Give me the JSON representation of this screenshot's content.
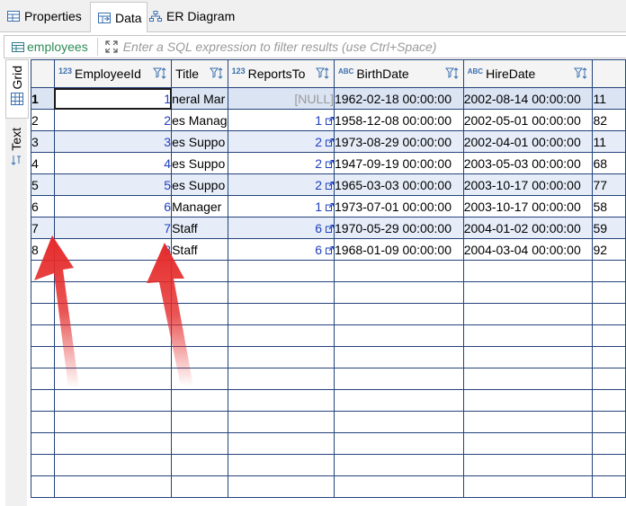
{
  "tabs": [
    {
      "label": "Properties",
      "icon": "table-icon",
      "active": false
    },
    {
      "label": "Data",
      "icon": "data-table-icon",
      "active": true
    },
    {
      "label": "ER Diagram",
      "icon": "er-diagram-icon",
      "active": false
    }
  ],
  "filter": {
    "table_name": "employees",
    "placeholder": "Enter a SQL expression to filter results (use Ctrl+Space)"
  },
  "side_tabs": [
    "Grid",
    "Text"
  ],
  "columns": [
    {
      "name": "EmployeeId",
      "type_label": "123"
    },
    {
      "name": "Title",
      "type_label": ""
    },
    {
      "name": "ReportsTo",
      "type_label": "123"
    },
    {
      "name": "BirthDate",
      "type_label": "ABC"
    },
    {
      "name": "HireDate",
      "type_label": "ABC"
    }
  ],
  "rows": [
    {
      "n": "1",
      "id": "1",
      "title": "neral Mar",
      "reports": "[NULL]",
      "birth": "1962-02-18 00:00:00",
      "hire": "2002-08-14 00:00:00",
      "extra": "11"
    },
    {
      "n": "2",
      "id": "2",
      "title": "es Manag",
      "reports": "1",
      "birth": "1958-12-08 00:00:00",
      "hire": "2002-05-01 00:00:00",
      "extra": "82"
    },
    {
      "n": "3",
      "id": "3",
      "title": "es Suppo",
      "reports": "2",
      "birth": "1973-08-29 00:00:00",
      "hire": "2002-04-01 00:00:00",
      "extra": "11"
    },
    {
      "n": "4",
      "id": "4",
      "title": "es Suppo",
      "reports": "2",
      "birth": "1947-09-19 00:00:00",
      "hire": "2003-05-03 00:00:00",
      "extra": "68"
    },
    {
      "n": "5",
      "id": "5",
      "title": "es Suppo",
      "reports": "2",
      "birth": "1965-03-03 00:00:00",
      "hire": "2003-10-17 00:00:00",
      "extra": "77"
    },
    {
      "n": "6",
      "id": "6",
      "title": "Manager",
      "reports": "1",
      "birth": "1973-07-01 00:00:00",
      "hire": "2003-10-17 00:00:00",
      "extra": "58"
    },
    {
      "n": "7",
      "id": "7",
      "title": "Staff",
      "reports": "6",
      "birth": "1970-05-29 00:00:00",
      "hire": "2004-01-02 00:00:00",
      "extra": "59"
    },
    {
      "n": "8",
      "id": "8",
      "title": "Staff",
      "reports": "6",
      "birth": "1968-01-09 00:00:00",
      "hire": "2004-03-04 00:00:00",
      "extra": "92"
    }
  ],
  "colors": {
    "accent": "#8fbbe8",
    "stripe": "#e6edf8",
    "grid_line": "#24437a",
    "arrow": "#e52a2a",
    "link": "#1f3fbf"
  }
}
